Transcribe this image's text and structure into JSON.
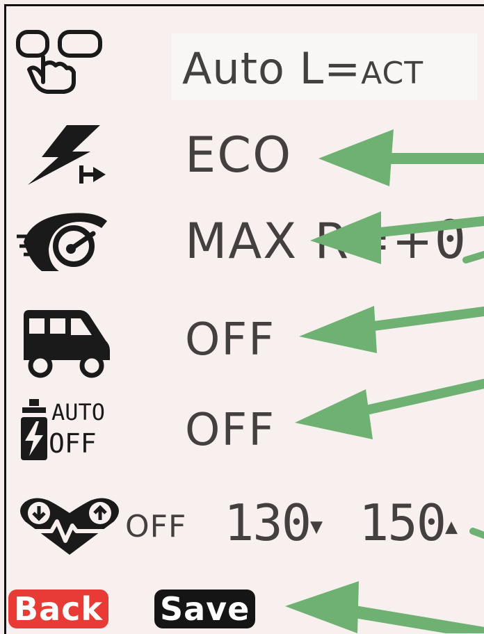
{
  "rows": {
    "assist_mode": {
      "icon": "touch-buttons-icon",
      "main": "Auto L=",
      "small": "ACT"
    },
    "power_mode": {
      "icon": "lightning-bolt-icon",
      "value": "ECO"
    },
    "regen": {
      "icon": "speedometer-icon",
      "value": "MAX R=",
      "sign": "+",
      "digit": "0"
    },
    "vehicle": {
      "icon": "van-icon",
      "value": "OFF"
    },
    "auto_off": {
      "icon": "auto-off-icon",
      "icon_text_1": "AUTO",
      "icon_text_2": "OFF",
      "value": "OFF"
    },
    "heart_rate": {
      "icon": "heart-rate-icon",
      "status": "OFF",
      "low": "130",
      "low_arrow": "▼",
      "high": "150",
      "high_arrow": "▲"
    }
  },
  "buttons": {
    "back": "Back",
    "save": "Save"
  },
  "colors": {
    "arrow_green": "#6fb073",
    "back_red": "#e83b35",
    "save_black": "#151515",
    "text": "#44403f"
  }
}
